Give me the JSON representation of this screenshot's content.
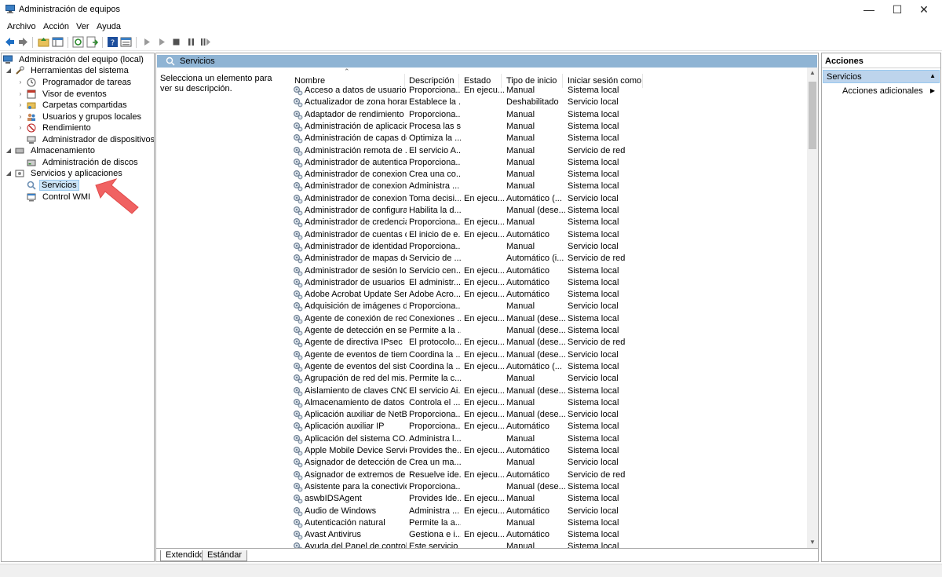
{
  "window": {
    "title": "Administración de equipos",
    "minimize": "—",
    "maximize": "☐",
    "close": "✕"
  },
  "menu": [
    "Archivo",
    "Acción",
    "Ver",
    "Ayuda"
  ],
  "tree": {
    "root": "Administración del equipo (local)",
    "groups": [
      {
        "label": "Herramientas del sistema",
        "children": [
          "Programador de tareas",
          "Visor de eventos",
          "Carpetas compartidas",
          "Usuarios y grupos locales",
          "Rendimiento",
          "Administrador de dispositivos"
        ]
      },
      {
        "label": "Almacenamiento",
        "children": [
          "Administración de discos"
        ]
      },
      {
        "label": "Servicios y aplicaciones",
        "children": [
          "Servicios",
          "Control WMI"
        ]
      }
    ]
  },
  "center": {
    "header": "Servicios",
    "description": "Selecciona un elemento para ver su descripción.",
    "columns": [
      "Nombre",
      "Descripción",
      "Estado",
      "Tipo de inicio",
      "Iniciar sesión como"
    ],
    "rows": [
      [
        "Acceso a datos de usuarios_...",
        "Proporciona...",
        "En ejecu...",
        "Manual",
        "Sistema local"
      ],
      [
        "Actualizador de zona horari...",
        "Establece la ...",
        "",
        "Deshabilitado",
        "Servicio local"
      ],
      [
        "Adaptador de rendimiento ...",
        "Proporciona...",
        "",
        "Manual",
        "Sistema local"
      ],
      [
        "Administración de aplicacio...",
        "Procesa las s...",
        "",
        "Manual",
        "Sistema local"
      ],
      [
        "Administración de capas de...",
        "Optimiza la ...",
        "",
        "Manual",
        "Sistema local"
      ],
      [
        "Administración remota de ...",
        "El servicio A...",
        "",
        "Manual",
        "Servicio de red"
      ],
      [
        "Administrador de autentica...",
        "Proporciona...",
        "",
        "Manual",
        "Sistema local"
      ],
      [
        "Administrador de conexion...",
        "Crea una co...",
        "",
        "Manual",
        "Sistema local"
      ],
      [
        "Administrador de conexion...",
        "Administra ...",
        "",
        "Manual",
        "Sistema local"
      ],
      [
        "Administrador de conexion...",
        "Toma decisi...",
        "En ejecu...",
        "Automático (...",
        "Servicio local"
      ],
      [
        "Administrador de configura...",
        "Habilita la d...",
        "",
        "Manual (dese...",
        "Sistema local"
      ],
      [
        "Administrador de credencia...",
        "Proporciona...",
        "En ejecu...",
        "Manual",
        "Sistema local"
      ],
      [
        "Administrador de cuentas d...",
        "El inicio de e...",
        "En ejecu...",
        "Automático",
        "Sistema local"
      ],
      [
        "Administrador de identidad...",
        "Proporciona...",
        "",
        "Manual",
        "Servicio local"
      ],
      [
        "Administrador de mapas de...",
        "Servicio de ...",
        "",
        "Automático (i...",
        "Servicio de red"
      ],
      [
        "Administrador de sesión local",
        "Servicio cen...",
        "En ejecu...",
        "Automático",
        "Sistema local"
      ],
      [
        "Administrador de usuarios",
        "El administr...",
        "En ejecu...",
        "Automático",
        "Sistema local"
      ],
      [
        "Adobe Acrobat Update Serv...",
        "Adobe Acro...",
        "En ejecu...",
        "Automático",
        "Sistema local"
      ],
      [
        "Adquisición de imágenes d...",
        "Proporciona...",
        "",
        "Manual",
        "Servicio local"
      ],
      [
        "Agente de conexión de red",
        "Conexiones ...",
        "En ejecu...",
        "Manual (dese...",
        "Sistema local"
      ],
      [
        "Agente de detección en seg...",
        "Permite a la ...",
        "",
        "Manual (dese...",
        "Sistema local"
      ],
      [
        "Agente de directiva IPsec",
        "El protocolo...",
        "En ejecu...",
        "Manual (dese...",
        "Servicio de red"
      ],
      [
        "Agente de eventos de tiempo",
        "Coordina la ...",
        "En ejecu...",
        "Manual (dese...",
        "Servicio local"
      ],
      [
        "Agente de eventos del siste...",
        "Coordina la ...",
        "En ejecu...",
        "Automático (...",
        "Sistema local"
      ],
      [
        "Agrupación de red del mis...",
        "Permite la c...",
        "",
        "Manual",
        "Servicio local"
      ],
      [
        "Aislamiento de claves CNG",
        "El servicio Ai...",
        "En ejecu...",
        "Manual (dese...",
        "Sistema local"
      ],
      [
        "Almacenamiento de datos ...",
        "Controla el ...",
        "En ejecu...",
        "Manual",
        "Sistema local"
      ],
      [
        "Aplicación auxiliar de NetBI...",
        "Proporciona...",
        "En ejecu...",
        "Manual (dese...",
        "Servicio local"
      ],
      [
        "Aplicación auxiliar IP",
        "Proporciona...",
        "En ejecu...",
        "Automático",
        "Sistema local"
      ],
      [
        "Aplicación del sistema CO...",
        "Administra l...",
        "",
        "Manual",
        "Sistema local"
      ],
      [
        "Apple Mobile Device Service",
        "Provides the...",
        "En ejecu...",
        "Automático",
        "Sistema local"
      ],
      [
        "Asignador de detección de ...",
        "Crea un ma...",
        "",
        "Manual",
        "Servicio local"
      ],
      [
        "Asignador de extremos de R...",
        "Resuelve ide...",
        "En ejecu...",
        "Automático",
        "Servicio de red"
      ],
      [
        "Asistente para la conectivid...",
        "Proporciona...",
        "",
        "Manual (dese...",
        "Sistema local"
      ],
      [
        "aswbIDSAgent",
        "Provides Ide...",
        "En ejecu...",
        "Manual",
        "Sistema local"
      ],
      [
        "Audio de Windows",
        "Administra ...",
        "En ejecu...",
        "Automático",
        "Servicio local"
      ],
      [
        "Autenticación natural",
        "Permite la a...",
        "",
        "Manual",
        "Sistema local"
      ],
      [
        "Avast Antivirus",
        "Gestiona e i...",
        "En ejecu...",
        "Automático",
        "Sistema local"
      ],
      [
        "Ayuda del Panel de control",
        "Este servicio",
        "",
        "Manual",
        "Sistema local"
      ]
    ],
    "tabs": [
      "Extendido",
      "Estándar"
    ]
  },
  "actions": {
    "title": "Acciones",
    "section": "Servicios",
    "items": [
      "Acciones adicionales"
    ]
  },
  "colors": {
    "header_blue": "#8fb4d4",
    "selection": "#cce4f7",
    "annotation_arrow": "#f06060"
  }
}
